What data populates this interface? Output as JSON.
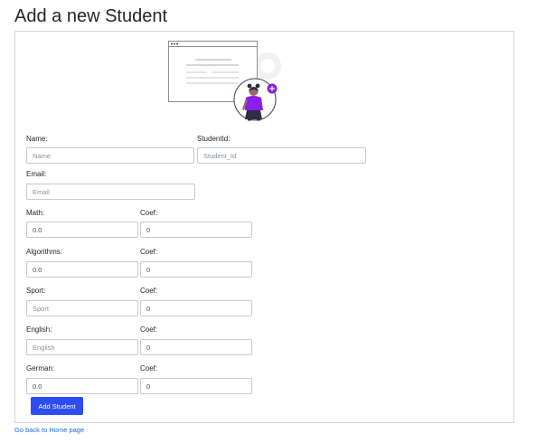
{
  "page": {
    "title": "Add a new Student"
  },
  "form": {
    "name": {
      "label": "Name:",
      "placeholder": "Name",
      "value": ""
    },
    "student_id": {
      "label": "StudentId:",
      "placeholder": "Student_Id",
      "value": ""
    },
    "email": {
      "label": "Email:",
      "placeholder": "Email",
      "value": ""
    },
    "subjects": [
      {
        "label": "Math:",
        "placeholder": "",
        "value": "0.0",
        "coef_label": "Coef:",
        "coef_value": "0"
      },
      {
        "label": "Algorithms:",
        "placeholder": "",
        "value": "0.0",
        "coef_label": "Coef:",
        "coef_value": "0"
      },
      {
        "label": "Sport:",
        "placeholder": "Sport",
        "value": "",
        "coef_label": "Coef:",
        "coef_value": "0"
      },
      {
        "label": "English:",
        "placeholder": "English",
        "value": "",
        "coef_label": "Coef:",
        "coef_value": "0"
      },
      {
        "label": "German:",
        "placeholder": "",
        "value": "0.0",
        "coef_label": "Coef:",
        "coef_value": "0"
      }
    ],
    "submit_label": "Add Student"
  },
  "footer": {
    "back_link": "Go back to Home page"
  },
  "colors": {
    "accent": "#2d4df2",
    "illustration_purple": "#8b1ee8",
    "link": "#1a6be0"
  },
  "icons": {
    "illustration": "add-user-illustration"
  }
}
